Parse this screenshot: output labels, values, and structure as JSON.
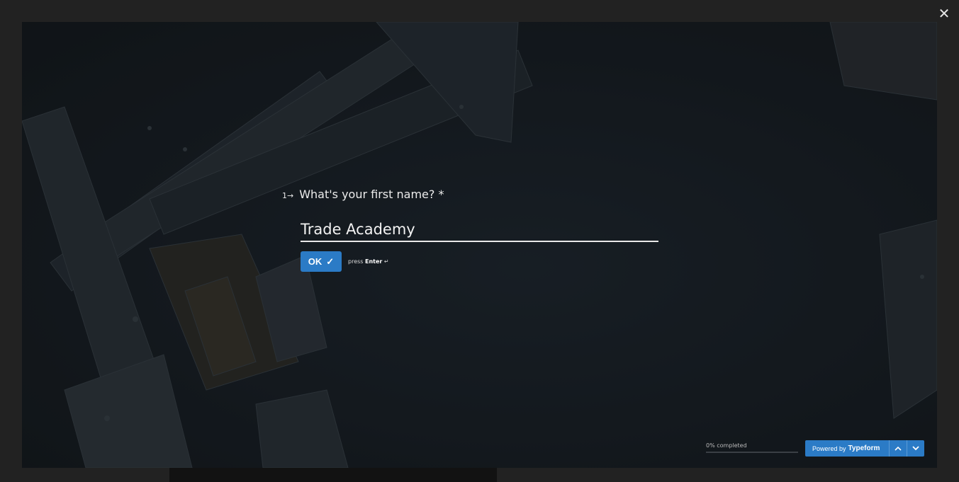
{
  "window": {
    "close_glyph": "✕"
  },
  "question": {
    "number": "1",
    "arrow": "→",
    "text": "What's your first name? *"
  },
  "answer": {
    "value": "Trade Academy",
    "placeholder": ""
  },
  "ok_button": {
    "label": "OK",
    "check": "✓"
  },
  "hint": {
    "prefix": "press",
    "key": "Enter",
    "glyph": "↵"
  },
  "progress": {
    "label": "0% completed",
    "percent": 0
  },
  "footer": {
    "powered_prefix": "Powered by",
    "brand": "Typeform",
    "prev_icon": "chevron-up-icon",
    "next_icon": "chevron-down-icon"
  },
  "colors": {
    "accent": "#2b7bc6",
    "text": "#ececec",
    "backdrop": "#222222"
  }
}
